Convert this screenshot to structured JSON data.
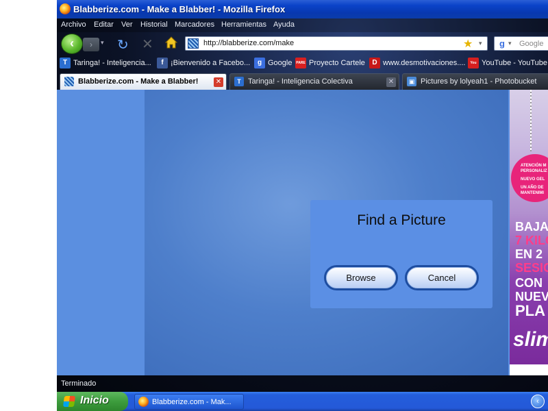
{
  "window": {
    "title": "Blabberize.com - Make a Blabber! - Mozilla Firefox"
  },
  "menu": [
    "Archivo",
    "Editar",
    "Ver",
    "Historial",
    "Marcadores",
    "Herramientas",
    "Ayuda"
  ],
  "nav": {
    "back_glyph": "‹",
    "forward_glyph": "›",
    "history_glyph": "▾",
    "reload_glyph": "↻",
    "stop_glyph": "✕",
    "url": "http://blabberize.com/make",
    "search_placeholder": "Google"
  },
  "bookmarks": [
    {
      "icon": "T",
      "label": "Taringa! - Inteligencia...",
      "color": "#2b6ed0"
    },
    {
      "icon": "f",
      "label": "¡Bienvenido a Facebo...",
      "color": "#3b5998"
    },
    {
      "icon": "g",
      "label": "Google",
      "color": "#3b6fe0"
    },
    {
      "icon": "PARE",
      "label": "Proyecto Cartele",
      "color": "#d82020"
    },
    {
      "icon": "D",
      "label": "www.desmotivaciones....",
      "color": "#c81818"
    },
    {
      "icon": "You",
      "label": "YouTube - YouTube",
      "color": "#d61f1f"
    }
  ],
  "tabs": [
    {
      "label": "Blabberize.com - Make a Blabber!",
      "active": true
    },
    {
      "label": "Taringa! - Inteligencia Colectiva",
      "active": false
    },
    {
      "label": "Pictures by lolyeah1 - Photobucket",
      "active": false
    }
  ],
  "dialog": {
    "heading": "Find a Picture",
    "browse_label": "Browse",
    "cancel_label": "Cancel"
  },
  "ad": {
    "tag_lines": [
      "ATENCIÓN M",
      "PERSONALIZ",
      "NUEVO GEL",
      "UN AÑO DE",
      "MANTENIMI"
    ],
    "lines": [
      "BAJA",
      "7 KILO",
      "EN 2",
      "SESION",
      "CON",
      "NUEV",
      "PLA",
      "slim"
    ]
  },
  "status": {
    "text": "Terminado"
  },
  "taskbar": {
    "start_label": "Inicio",
    "task_label": "Blabberize.com - Mak...",
    "tray_glyph": "‹"
  },
  "colors": {
    "stage": "#4e7fcb",
    "dialog": "#5b8fe4",
    "pill_border": "#1d4da0",
    "sidebar": "#5b8fe0"
  }
}
